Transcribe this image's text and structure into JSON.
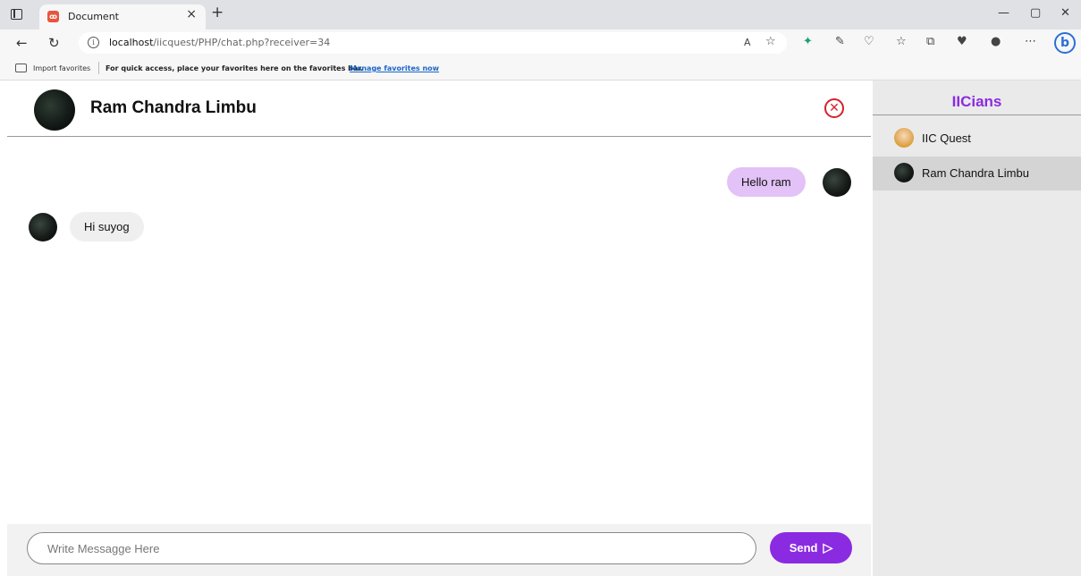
{
  "browser": {
    "tab_title": "Document",
    "tab_close": "×",
    "new_tab": "+",
    "url_host": "localhost",
    "url_path": "/iicquest/PHP/chat.php?receiver=34",
    "favorites": {
      "import_label": "Import favorites",
      "message": "For quick access, place your favorites here on the favorites bar.",
      "manage_link": "Manage favorites now"
    }
  },
  "chat": {
    "receiver_name": "Ram Chandra Limbu",
    "messages": [
      {
        "direction": "outgoing",
        "text": "Hello ram"
      },
      {
        "direction": "incoming",
        "text": "Hi suyog"
      }
    ],
    "input_placeholder": "Write Messagge Here",
    "send_label": "Send"
  },
  "sidebar": {
    "title": "IICians",
    "users": [
      {
        "name": "IIC Quest",
        "avatar": "cartoon-avatar",
        "active": false
      },
      {
        "name": "Ram Chandra Limbu",
        "avatar": "dark-avatar",
        "active": true
      }
    ]
  },
  "colors": {
    "accent": "#8a2be2",
    "outgoing_bubble": "#e3c2f7",
    "incoming_bubble": "#efefef",
    "close_red": "#d6222c"
  }
}
